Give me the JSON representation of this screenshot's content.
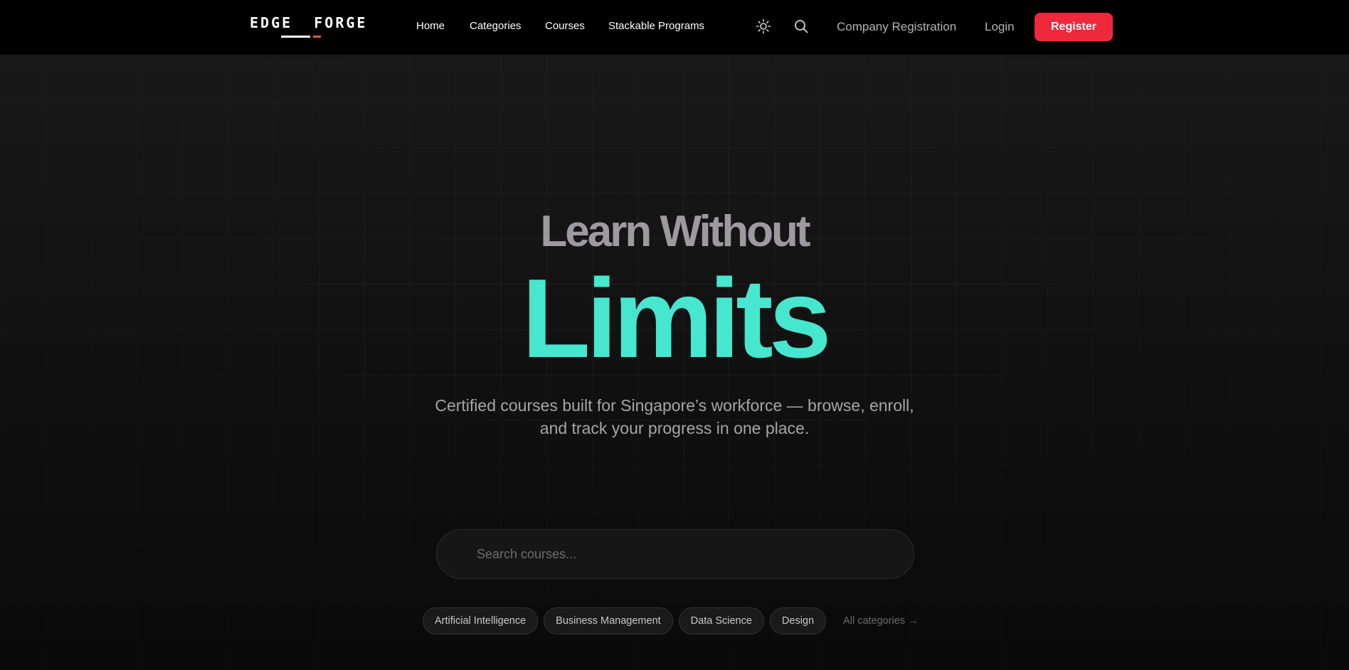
{
  "brand": {
    "logo": "EDGE  FORGE"
  },
  "nav": {
    "links": [
      "Home",
      "Categories",
      "Courses",
      "Stackable Programs"
    ],
    "company_registration": "Company Registration",
    "login": "Login",
    "register": "Register"
  },
  "hero": {
    "title_line1": "Learn Without",
    "title_line2": "Limits",
    "subtitle": "Certified courses built for Singapore’s workforce — browse, enroll, and track your progress in one place.",
    "search_placeholder": "Search courses...",
    "categories": [
      "Artificial Intelligence",
      "Business Management",
      "Data Science",
      "Design"
    ],
    "all_categories": "All categories →"
  },
  "colors": {
    "accent": "#46e6cf",
    "register": "#f0283c",
    "logo_underline": "#e35a2b"
  },
  "icons": [
    "sun-icon",
    "search-icon"
  ]
}
